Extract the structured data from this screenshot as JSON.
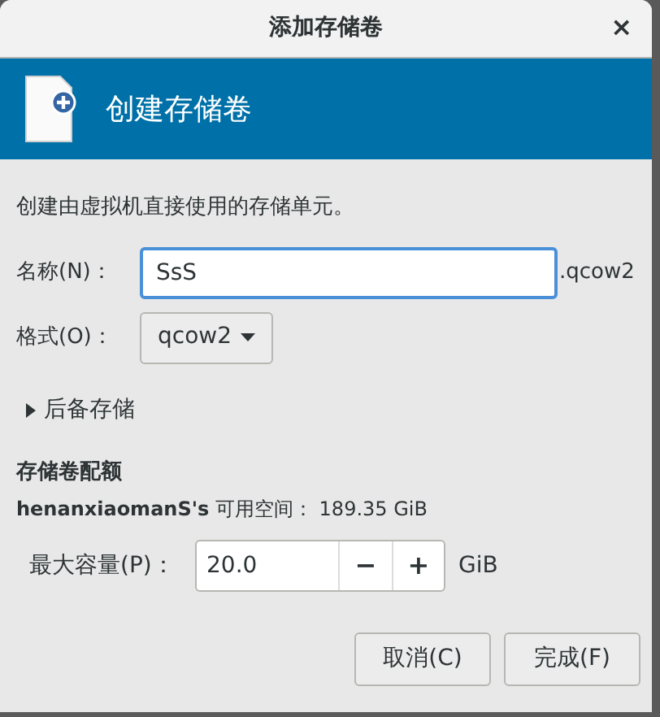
{
  "window": {
    "title": "添加存储卷",
    "close": "×"
  },
  "header": {
    "title": "创建存储卷"
  },
  "description": "创建由虚拟机直接使用的存储单元。",
  "name_field": {
    "label": "名称(N)：",
    "value": "SsS",
    "suffix": ".qcow2",
    "focused": true
  },
  "format": {
    "label": "格式(O)：",
    "value": "qcow2"
  },
  "backing_store": {
    "label": "后备存储",
    "expanded": false
  },
  "quota": {
    "heading": "存储卷配额",
    "available": "**henanxiaomanS's** 可用空间： 189.35 GiB",
    "capacity": {
      "label": "最大容量(P)：",
      "value": "20.0",
      "decrement": "−",
      "increment": "+",
      "unit": "GiB"
    }
  },
  "buttons": [
    {
      "label": "取消(C)"
    },
    {
      "label": "完成(F)"
    }
  ]
}
